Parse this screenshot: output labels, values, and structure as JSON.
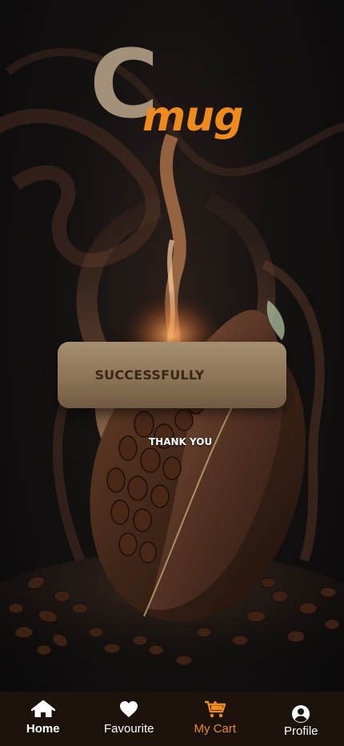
{
  "logo": {
    "letter": "C",
    "word": "mug"
  },
  "status": {
    "button_label": "SUCCESSFULLY",
    "message": "THANK YOU"
  },
  "nav": {
    "items": [
      {
        "label": "Home",
        "icon": "home-icon",
        "active": true
      },
      {
        "label": "Favourite",
        "icon": "heart-icon",
        "active": false
      },
      {
        "label": "My Cart",
        "icon": "cart-icon",
        "active": false
      },
      {
        "label": "Profile",
        "icon": "profile-icon",
        "active": false
      }
    ]
  },
  "colors": {
    "accent": "#f08a1d",
    "logo_c": "#a39179",
    "nav_bg": "#1b1209",
    "button_text": "#3a2616"
  }
}
